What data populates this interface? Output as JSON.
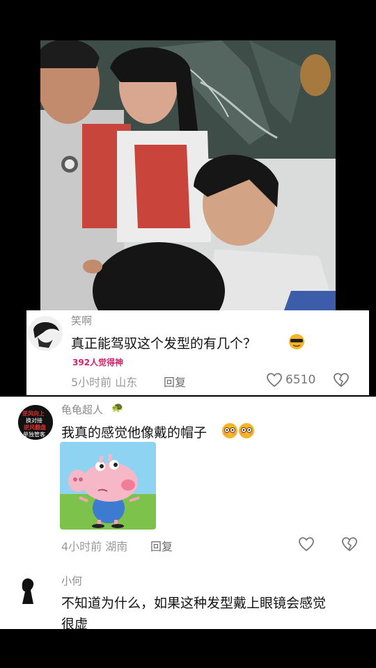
{
  "comments": [
    {
      "username": "笑啊",
      "text": "真正能驾驭这个发型的有几个？",
      "badge": "392人觉得神",
      "time_location": "5小时前 山东",
      "reply_label": "回复",
      "likes": "6510"
    },
    {
      "username": "龟龟超人",
      "username_emoji": "🐢",
      "text": "我真的感觉他像戴的帽子",
      "emoji": "😳😳",
      "avatar_text": [
        "逆风向上",
        "换对接",
        "逆风翻盘",
        "单独管客"
      ],
      "time_location": "4小时前 湖南",
      "reply_label": "回复"
    },
    {
      "username": "小何",
      "text_line1": "不知道为什么，如果这种发型戴上眼镜会感觉",
      "text_line2": "很虚"
    }
  ],
  "colors": {
    "background": "#000000",
    "card": "#ffffff",
    "badge": "#d61f6a",
    "muted": "#9a9a9a"
  }
}
